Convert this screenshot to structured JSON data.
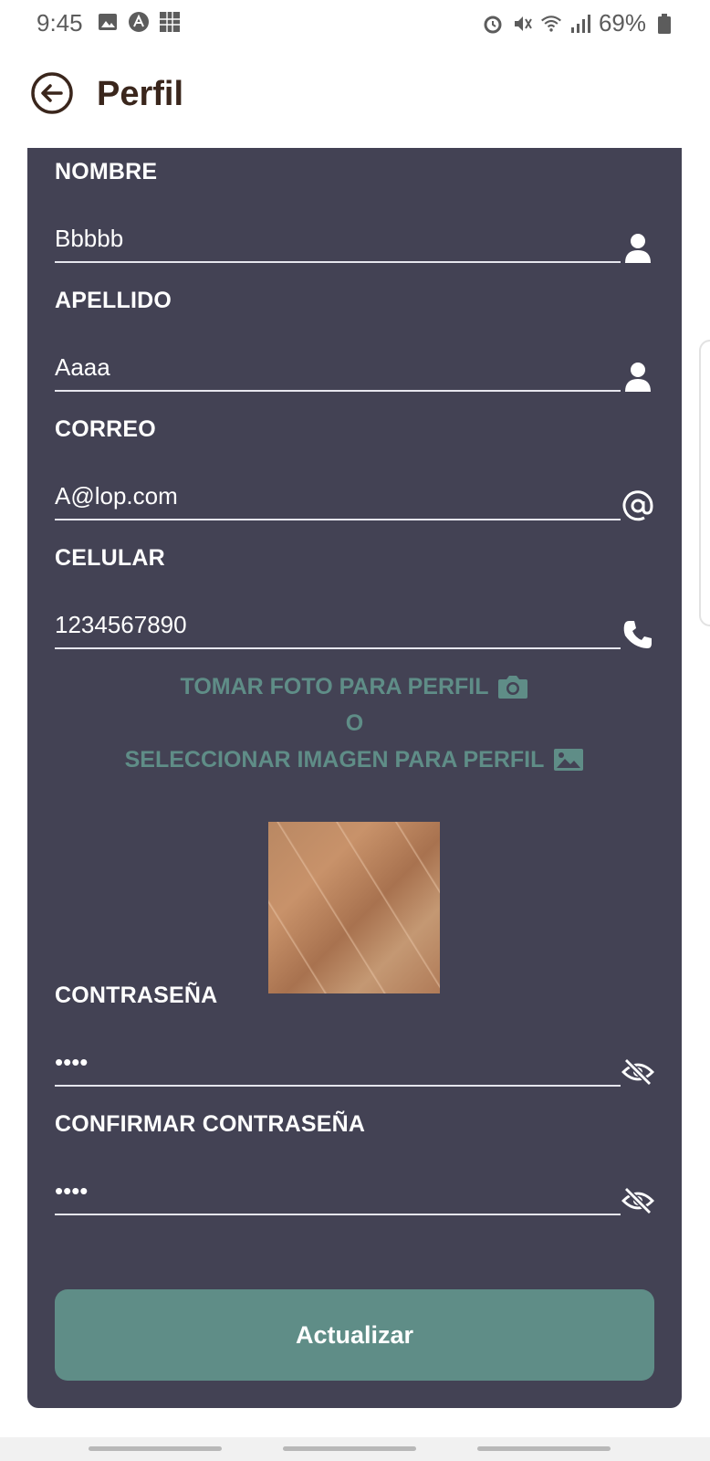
{
  "status_bar": {
    "time": "9:45",
    "battery": "69%"
  },
  "header": {
    "title": "Perfil"
  },
  "form": {
    "nombre": {
      "label": "NOMBRE",
      "value": "Bbbbb"
    },
    "apellido": {
      "label": "APELLIDO",
      "value": "Aaaa"
    },
    "correo": {
      "label": "CORREO",
      "value": "A@lop.com"
    },
    "celular": {
      "label": "CELULAR",
      "value": "1234567890"
    },
    "contrasena": {
      "label": "CONTRASEÑA",
      "value": "••••"
    },
    "confirmar": {
      "label": "CONFIRMAR CONTRASEÑA",
      "value": "••••"
    }
  },
  "photo": {
    "take_label": "TOMAR FOTO PARA PERFIL",
    "or_label": "O",
    "select_label": "SELECCIONAR IMAGEN PARA PERFIL"
  },
  "submit_label": "Actualizar",
  "colors": {
    "card": "#434254",
    "accent": "#5f8d87",
    "title": "#3a261c"
  },
  "icons": {
    "nombre": "person-icon",
    "apellido": "person-icon",
    "correo": "at-icon",
    "celular": "phone-icon",
    "contrasena": "eye-off-icon",
    "confirmar": "eye-off-icon",
    "take_photo": "camera-icon",
    "select_image": "image-icon"
  }
}
